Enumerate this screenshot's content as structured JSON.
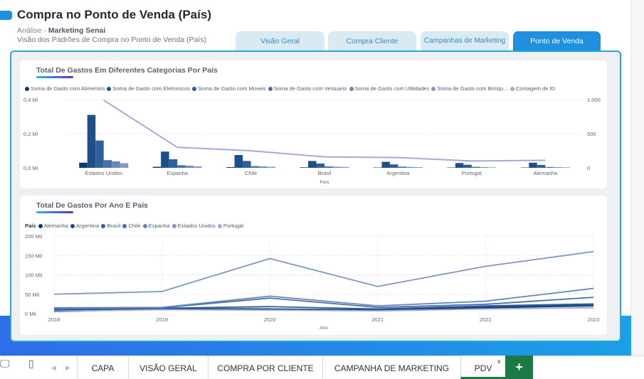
{
  "header": {
    "title": "Compra no Ponto de Venda (País)",
    "analysis_label": "Análise - ",
    "analysis_name": "Marketing Senai",
    "subtitle": "Visão dos Padrões de Compra no Ponto de Venda (País)"
  },
  "tabs": [
    {
      "label": "Visão Geral"
    },
    {
      "label": "Compra  Cliente"
    },
    {
      "label": "Campanhas de Marketing"
    },
    {
      "label": "Ponto de Venda"
    }
  ],
  "colors": {
    "accent": "#1f8fe0",
    "panel_border": "#22a7e0",
    "series_alimentos": "#11386b",
    "series_eletronicos": "#1f4f8a",
    "series_moveis": "#2f5f98",
    "series_vestuario": "#4a6fa8",
    "series_utilidades": "#6a86bd",
    "series_brinquedos": "#8096c8",
    "series_contagem": "#a3a9de",
    "excel_green": "#1b7a43"
  },
  "chart1": {
    "title": "Total De Gastos Em Diferentes Categorias Por País",
    "legend": [
      "Soma de Gasto com Alimentos",
      "Soma de Gasto com Eletronicos",
      "Soma de Gasto com Moveis",
      "Soma de Gasto com Vestuario",
      "Soma de Gasto com Utilidades",
      "Soma de Gasto com Brinqu...",
      "Contagem de ID"
    ],
    "y_ticks": [
      "0,4 Mi",
      "0,2 Mi",
      "0,0 Mi"
    ],
    "y2_ticks": [
      "1.000",
      "500",
      "0"
    ],
    "x_label": "País"
  },
  "chart2": {
    "title": "Total De Gastos Por Ano E País",
    "legend_lead": "País",
    "legend": [
      "Alemanha",
      "Argentina",
      "Brasil",
      "Chile",
      "Espanha",
      "Estados Unidos",
      "Portugal"
    ],
    "y_ticks": [
      "200 Mil",
      "150 Mil",
      "100 Mil",
      "50 Mil",
      "0 Mil"
    ],
    "x_label": "Ano"
  },
  "chart_data": [
    {
      "type": "bar",
      "title": "Total De Gastos Em Diferentes Categorias Por País",
      "xlabel": "País",
      "ylabel": "",
      "ylim": [
        0,
        0.4
      ],
      "y2lim": [
        0,
        1000
      ],
      "categories": [
        "Estados Unidos",
        "Espanha",
        "Chile",
        "Brasil",
        "Argentina",
        "Portugal",
        "Alemanha"
      ],
      "series": [
        {
          "name": "Soma de Gasto com Alimentos",
          "values": [
            0.03,
            0.006,
            0.004,
            0.003,
            0.002,
            0.002,
            0.002
          ]
        },
        {
          "name": "Soma de Gasto com Eletronicos",
          "values": [
            0.31,
            0.095,
            0.075,
            0.04,
            0.035,
            0.028,
            0.03
          ]
        },
        {
          "name": "Soma de Gasto com Moveis",
          "values": [
            0.16,
            0.05,
            0.04,
            0.025,
            0.02,
            0.018,
            0.017
          ]
        },
        {
          "name": "Soma de Gasto com Vestuario",
          "values": [
            0.045,
            0.015,
            0.01,
            0.008,
            0.007,
            0.006,
            0.005
          ]
        },
        {
          "name": "Soma de Gasto com Utilidades",
          "values": [
            0.038,
            0.012,
            0.008,
            0.006,
            0.005,
            0.004,
            0.004
          ]
        },
        {
          "name": "Soma de Gasto com Brinqu...",
          "values": [
            0.027,
            0.008,
            0.006,
            0.005,
            0.004,
            0.003,
            0.003
          ]
        }
      ],
      "line_series": {
        "name": "Contagem de ID",
        "axis": "secondary",
        "values": [
          990,
          300,
          250,
          160,
          150,
          100,
          110
        ]
      },
      "grid": false,
      "legend_position": "top"
    },
    {
      "type": "line",
      "title": "Total De Gastos Por Ano E País",
      "xlabel": "Ano",
      "ylabel": "",
      "ylim": [
        0,
        200000
      ],
      "x": [
        2018,
        2019,
        2020,
        2021,
        2022,
        2023
      ],
      "series": [
        {
          "name": "Alemanha",
          "values": [
            5000,
            12000,
            10000,
            8000,
            15000,
            20000
          ]
        },
        {
          "name": "Argentina",
          "values": [
            8000,
            13000,
            12000,
            10000,
            18000,
            22000
          ]
        },
        {
          "name": "Brasil",
          "values": [
            10000,
            14000,
            18000,
            12000,
            20000,
            25000
          ]
        },
        {
          "name": "Chile",
          "values": [
            12000,
            15000,
            40000,
            16000,
            24000,
            42000
          ]
        },
        {
          "name": "Espanha",
          "values": [
            15000,
            16000,
            45000,
            20000,
            32000,
            65000
          ]
        },
        {
          "name": "Estados Unidos",
          "values": [
            50000,
            57000,
            142000,
            70000,
            122000,
            160000
          ]
        },
        {
          "name": "Portugal",
          "values": [
            6000,
            10000,
            9000,
            7000,
            12000,
            15000
          ]
        }
      ],
      "grid": true,
      "legend_position": "top-left"
    }
  ],
  "sheet_tabs": {
    "tabs": [
      {
        "label": "CAPA"
      },
      {
        "label": "VISÃO GERAL"
      },
      {
        "label": "COMPRA POR CLIENTE"
      },
      {
        "label": "CAMPANHA DE MARKETING"
      },
      {
        "label": "PDV"
      }
    ],
    "close_label": "x",
    "add_label": "+"
  }
}
